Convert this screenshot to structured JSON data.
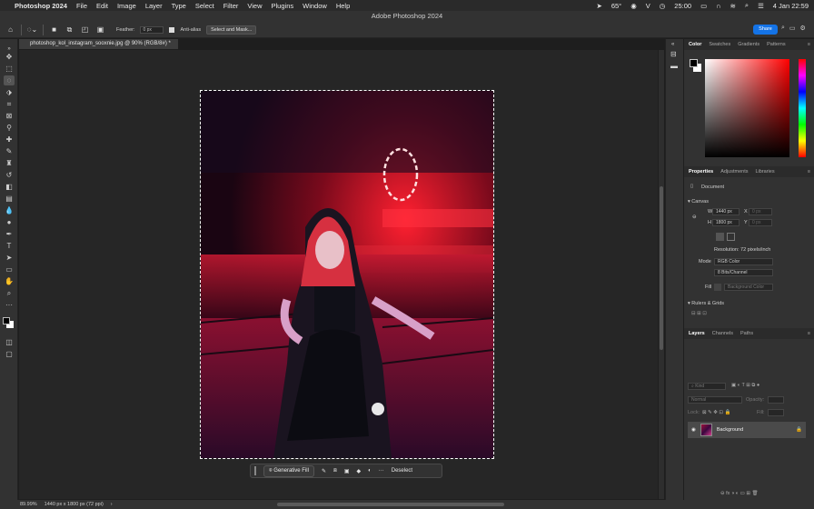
{
  "menubar": {
    "app_name": "Photoshop 2024",
    "items": [
      "File",
      "Edit",
      "Image",
      "Layer",
      "Type",
      "Select",
      "Filter",
      "View",
      "Plugins",
      "Window",
      "Help"
    ],
    "temperature": "65°",
    "time": "25:00",
    "date": "4 Jan  22:59"
  },
  "window_title": "Adobe Photoshop 2024",
  "options": {
    "feather_label": "Feather:",
    "feather_value": "0 px",
    "antialias_label": "Anti-alias",
    "select_mask_label": "Select and Mask..."
  },
  "share_label": "Share",
  "document_tab": "photoshop_kol_instagram_sooxnie.jpg @ 90% (RGB/8#) *",
  "contextual_taskbar": {
    "generative_fill": "Generative Fill",
    "deselect": "Deselect"
  },
  "status": {
    "zoom": "89.99%",
    "doc_info": "1440 px x 1800 px (72 ppi)"
  },
  "color_panel": {
    "tabs": [
      "Color",
      "Swatches",
      "Gradients",
      "Patterns"
    ]
  },
  "properties_panel": {
    "tabs": [
      "Properties",
      "Adjustments",
      "Libraries"
    ],
    "doc_label": "Document",
    "canvas_heading": "Canvas",
    "w_label": "W",
    "w_value": "1440 px",
    "h_label": "H",
    "h_value": "1800 px",
    "x_label": "X",
    "x_value": "0 px",
    "y_label": "Y",
    "y_value": "0 px",
    "resolution": "Resolution: 72 pixels/inch",
    "mode_label": "Mode",
    "mode_value": "RGB Color",
    "bits_value": "8 Bits/Channel",
    "fill_label": "Fill",
    "fill_value": "Background Color",
    "rulers_heading": "Rulers & Grids"
  },
  "layers_panel": {
    "tabs": [
      "Layers",
      "Channels",
      "Paths"
    ],
    "kind_placeholder": "Kind",
    "blend_mode": "Normal",
    "opacity_label": "Opacity:",
    "lock_label": "Lock:",
    "fill_label": "Fill:",
    "layer_name": "Background"
  }
}
